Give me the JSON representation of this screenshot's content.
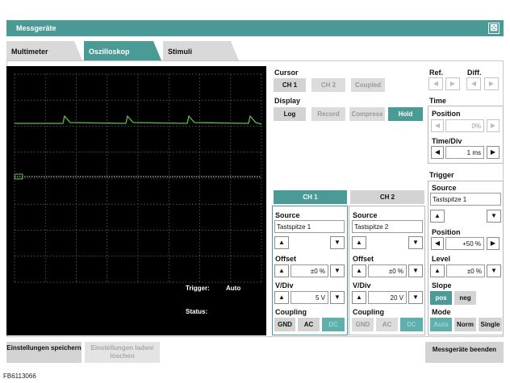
{
  "window": {
    "title": "Messgeräte",
    "close_symbol": "⊠"
  },
  "tabs": [
    {
      "label": "Multimeter",
      "active": false
    },
    {
      "label": "Oszilloskop",
      "active": true
    },
    {
      "label": "Stimuli",
      "active": false
    }
  ],
  "scope": {
    "trigger_label": "Trigger:",
    "trigger_value": "Auto",
    "status_label": "Status:",
    "status_value": "",
    "trace_color": "#5fbf4a"
  },
  "cursor": {
    "label": "Cursor",
    "ch1": "CH 1",
    "ch2": "CH 2",
    "coupled": "Coupled"
  },
  "display": {
    "label": "Display",
    "log": "Log",
    "record": "Record",
    "compress": "Compress",
    "hold": "Hold"
  },
  "ref": {
    "label": "Ref."
  },
  "diff": {
    "label": "Diff."
  },
  "time": {
    "label": "Time",
    "position_label": "Position",
    "position_value": "0%",
    "timediv_label": "Time/Div",
    "timediv_value": "1 ms"
  },
  "channels": [
    {
      "header": "CH 1",
      "active": true,
      "source_label": "Source",
      "source_value": "Tastspitze 1",
      "offset_label": "Offset",
      "offset_value": "±0 %",
      "vdiv_label": "V/Div",
      "vdiv_value": "5 V",
      "coupling_label": "Coupling",
      "gnd": "GND",
      "ac": "AC",
      "dc": "DC"
    },
    {
      "header": "CH 2",
      "active": false,
      "source_label": "Source",
      "source_value": "Tastspitze 2",
      "offset_label": "Offset",
      "offset_value": "±0 %",
      "vdiv_label": "V/Div",
      "vdiv_value": "20 V",
      "coupling_label": "Coupling",
      "gnd": "GND",
      "ac": "AC",
      "dc": "DC"
    }
  ],
  "trigger": {
    "label": "Trigger",
    "source_label": "Source",
    "source_value": "Tastspitze 1",
    "position_label": "Position",
    "position_value": "+50 %",
    "level_label": "Level",
    "level_value": "±0 %",
    "slope_label": "Slope",
    "pos": "pos",
    "neg": "neg",
    "mode_label": "Mode",
    "auto": "Auto",
    "norm": "Norm",
    "single": "Single"
  },
  "footer": {
    "save_settings": "Einstellungen speichern",
    "load_delete": "Einstellungen laden/ löschen",
    "close_instruments": "Messgeräte beenden",
    "figure_id": "FB6113066"
  },
  "colors": {
    "accent": "#4a9a96",
    "trace": "#5fbf4a"
  }
}
